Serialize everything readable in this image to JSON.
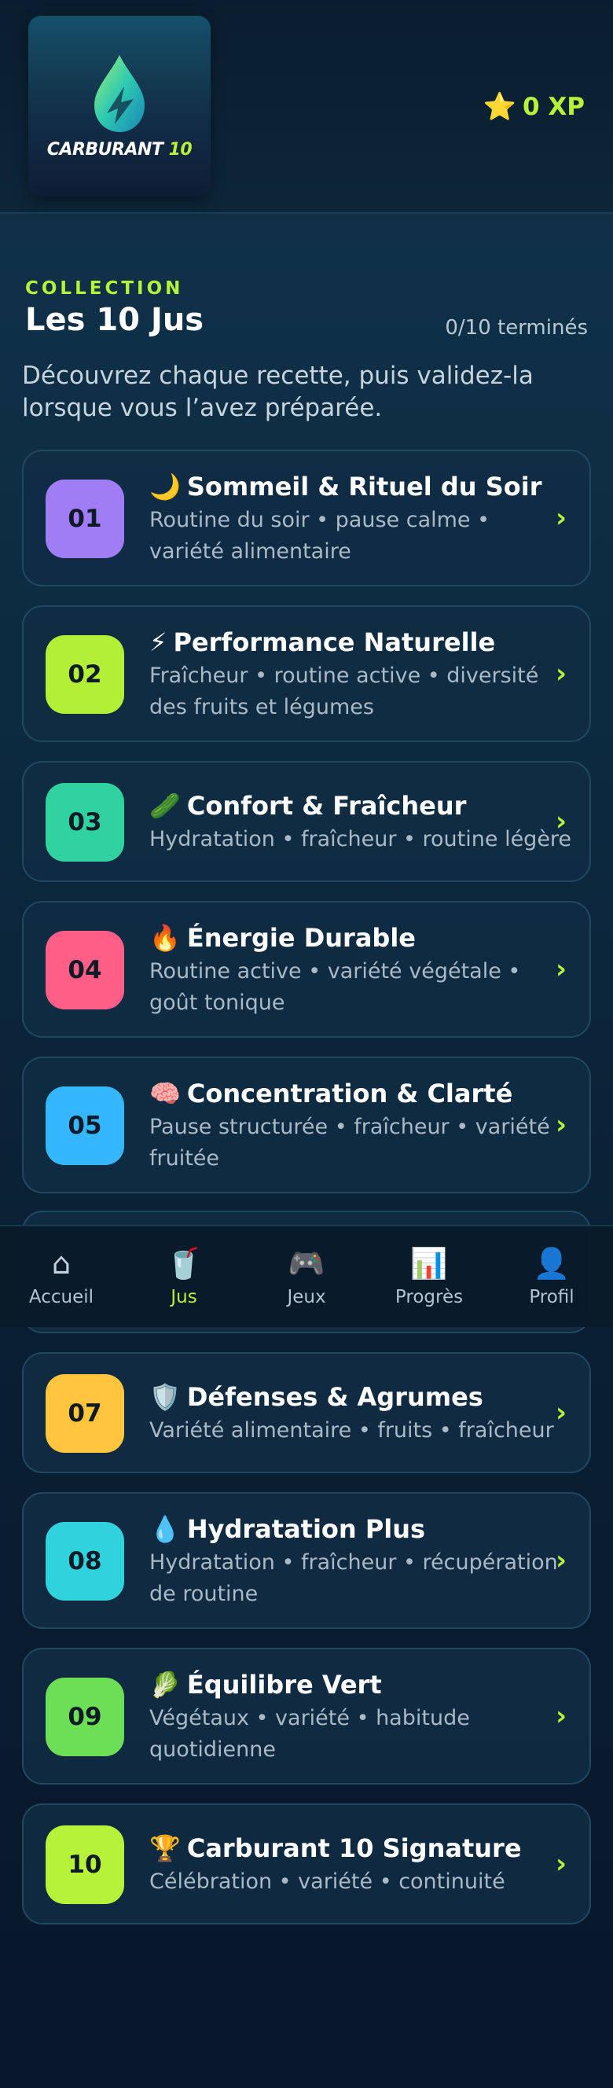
{
  "header": {
    "logo_text_main": "CARBURANT",
    "logo_text_num": "10",
    "xp_label": "0 XP",
    "star_icon": "⭐"
  },
  "section": {
    "eyebrow": "COLLECTION",
    "title": "Les 10 Jus",
    "progress": "0/10 terminés",
    "intro": "Découvrez chaque recette, puis validez-la lorsque vous l’avez préparée."
  },
  "cards": [
    {
      "num": "01",
      "emoji": "🌙",
      "title": "Sommeil & Rituel du Soir",
      "desc": "Routine du soir • pause calme • variété alimentaire",
      "color": "#a07cf5"
    },
    {
      "num": "02",
      "emoji": "⚡",
      "title": "Performance Naturelle",
      "desc": "Fraîcheur • routine active • diversité des fruits et légumes",
      "color": "#b3ef37"
    },
    {
      "num": "03",
      "emoji": "🥒",
      "title": "Confort & Fraîcheur",
      "desc": "Hydratation • fraîcheur • routine légère",
      "color": "#2fd3a0"
    },
    {
      "num": "04",
      "emoji": "🔥",
      "title": "Énergie Durable",
      "desc": "Routine active • variété végétale • goût tonique",
      "color": "#ff5f86"
    },
    {
      "num": "05",
      "emoji": "🧠",
      "title": "Concentration & Clarté",
      "desc": "Pause structurée • fraîcheur • variété fruitée",
      "color": "#35b7ff"
    },
    {
      "num": "07",
      "emoji": "🛡️",
      "title": "Défenses & Agrumes",
      "desc": "Variété alimentaire • fruits • fraîcheur",
      "color": "#ffc53d"
    },
    {
      "num": "08",
      "emoji": "💧",
      "title": "Hydratation Plus",
      "desc": "Hydratation • fraîcheur • récupération de routine",
      "color": "#2ed3dc"
    },
    {
      "num": "09",
      "emoji": "🥬",
      "title": "Équilibre Vert",
      "desc": "Végétaux • variété • habitude quotidienne",
      "color": "#6ddf57"
    },
    {
      "num": "10",
      "emoji": "🏆",
      "title": "Carburant 10 Signature",
      "desc": "Célébration • variété • continuité",
      "color": "#b7f23a"
    }
  ],
  "nav": [
    {
      "icon": "⌂",
      "label": "Accueil",
      "icon_name": "home-icon"
    },
    {
      "icon": "🥤",
      "label": "Jus",
      "icon_name": "juice-cup-icon",
      "active": true
    },
    {
      "icon": "🎮",
      "label": "Jeux",
      "icon_name": "gamepad-icon"
    },
    {
      "icon": "📊",
      "label": "Progrès",
      "icon_name": "bar-chart-icon"
    },
    {
      "icon": "👤",
      "label": "Profil",
      "icon_name": "user-icon"
    }
  ],
  "colors": {
    "accent": "#b7f23a",
    "background": "#0c2a40",
    "card_border": "#214862"
  }
}
